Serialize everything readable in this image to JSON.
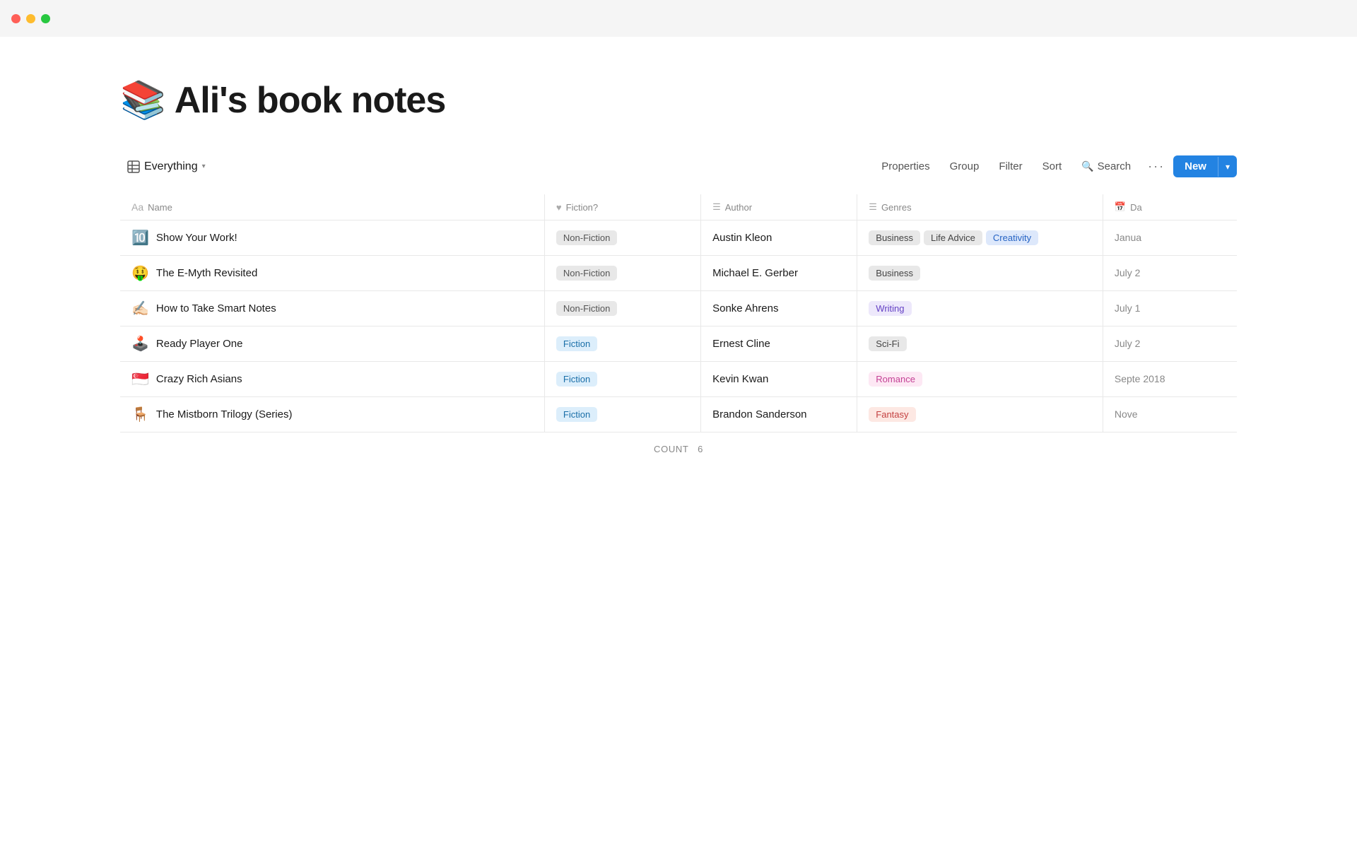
{
  "titlebar": {
    "close_label": "",
    "min_label": "",
    "max_label": ""
  },
  "page": {
    "icon": "📚",
    "title": "Ali's book notes"
  },
  "toolbar": {
    "view_icon": "table",
    "view_label": "Everything",
    "properties_label": "Properties",
    "group_label": "Group",
    "filter_label": "Filter",
    "sort_label": "Sort",
    "search_label": "Search",
    "more_label": "···",
    "new_label": "New"
  },
  "table": {
    "columns": [
      {
        "id": "name",
        "icon": "text",
        "label": "Name"
      },
      {
        "id": "fiction",
        "icon": "heart",
        "label": "Fiction?"
      },
      {
        "id": "author",
        "icon": "list",
        "label": "Author"
      },
      {
        "id": "genres",
        "icon": "list",
        "label": "Genres"
      },
      {
        "id": "date",
        "icon": "calendar",
        "label": "Da"
      }
    ],
    "rows": [
      {
        "emoji": "🔟",
        "name": "Show Your Work!",
        "fiction_type": "Non-Fiction",
        "fiction_class": "nonfiction",
        "author": "Austin Kleon",
        "genres": [
          {
            "label": "Business",
            "class": "tag-business"
          },
          {
            "label": "Life Advice",
            "class": "tag-lifeadvice"
          },
          {
            "label": "Creativity",
            "class": "tag-creativity"
          }
        ],
        "date": "Janua"
      },
      {
        "emoji": "🤑",
        "name": "The E-Myth Revisited",
        "fiction_type": "Non-Fiction",
        "fiction_class": "nonfiction",
        "author": "Michael E. Gerber",
        "genres": [
          {
            "label": "Business",
            "class": "tag-business"
          }
        ],
        "date": "July 2"
      },
      {
        "emoji": "✍🏻",
        "name": "How to Take Smart Notes",
        "fiction_type": "Non-Fiction",
        "fiction_class": "nonfiction",
        "author": "Sonke Ahrens",
        "genres": [
          {
            "label": "Writing",
            "class": "tag-writing"
          }
        ],
        "date": "July 1"
      },
      {
        "emoji": "🕹️",
        "name": "Ready Player One",
        "fiction_type": "Fiction",
        "fiction_class": "fiction",
        "author": "Ernest Cline",
        "genres": [
          {
            "label": "Sci-Fi",
            "class": "tag-scifi"
          }
        ],
        "date": "July 2"
      },
      {
        "emoji": "🇸🇬",
        "name": "Crazy Rich Asians",
        "fiction_type": "Fiction",
        "fiction_class": "fiction",
        "author": "Kevin Kwan",
        "genres": [
          {
            "label": "Romance",
            "class": "tag-romance"
          }
        ],
        "date": "Septe 2018"
      },
      {
        "emoji": "🪑",
        "name": "The Mistborn Trilogy (Series)",
        "fiction_type": "Fiction",
        "fiction_class": "fiction",
        "author": "Brandon Sanderson",
        "genres": [
          {
            "label": "Fantasy",
            "class": "tag-fantasy"
          }
        ],
        "date": "Nove"
      }
    ]
  },
  "footer": {
    "count_label": "COUNT",
    "count_value": "6"
  }
}
